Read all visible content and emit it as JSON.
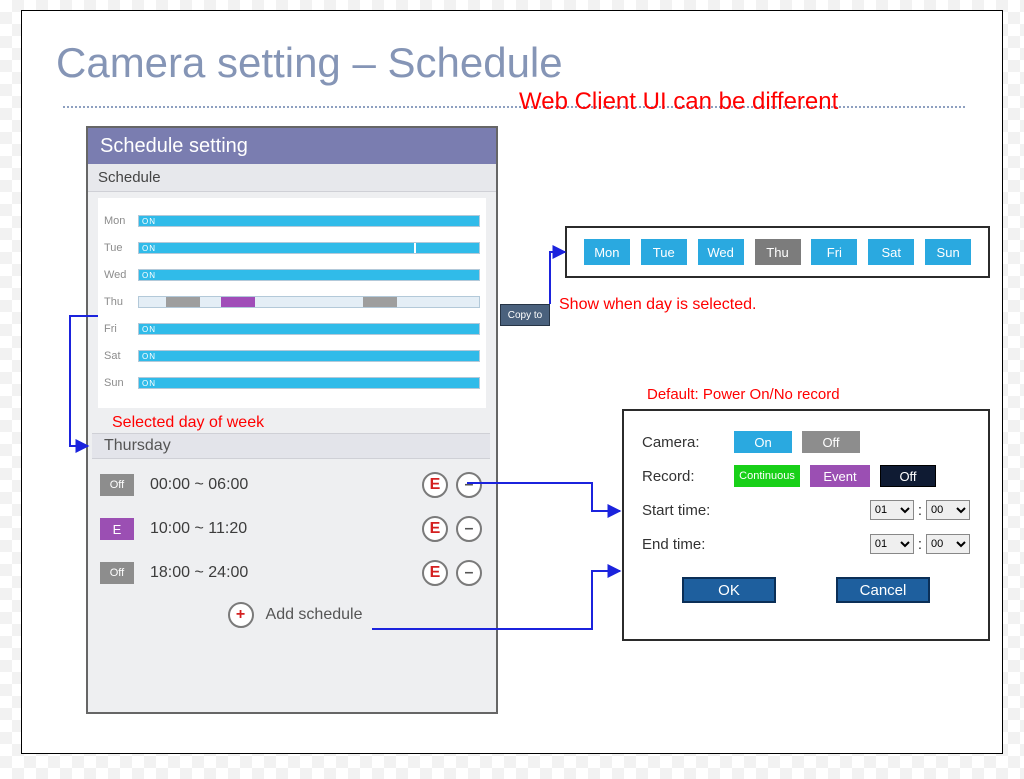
{
  "title": "Camera setting – Schedule",
  "warn_text": "Web Client UI can be different",
  "schedule": {
    "header": "Schedule setting",
    "subheader": "Schedule",
    "days": [
      "Mon",
      "Tue",
      "Wed",
      "Thu",
      "Fri",
      "Sat",
      "Sun"
    ],
    "on_chip": "ON",
    "copy_to": "Copy to"
  },
  "copy_strip": {
    "days": [
      "Mon",
      "Tue",
      "Wed",
      "Thu",
      "Fri",
      "Sat",
      "Sun"
    ],
    "selected": "Thu",
    "show_when": "Show when day is selected."
  },
  "selected_day_label": "Selected day of week",
  "detail": {
    "header": "Thursday",
    "items": [
      {
        "chip": "Off",
        "chipClass": "off",
        "range": "00:00 ~ 06:00"
      },
      {
        "chip": "E",
        "chipClass": "e",
        "range": "10:00 ~ 11:20"
      },
      {
        "chip": "Off",
        "chipClass": "off",
        "range": "18:00 ~ 24:00"
      }
    ],
    "add_label": "Add schedule"
  },
  "default_note": "Default: Power On/No record",
  "dialog": {
    "camera_label": "Camera:",
    "on": "On",
    "off": "Off",
    "record_label": "Record:",
    "continuous": "Continuous",
    "event": "Event",
    "off2": "Off",
    "start_label": "Start time:",
    "end_label": "End time:",
    "hour": "01",
    "minute": "00",
    "ok": "OK",
    "cancel": "Cancel"
  }
}
